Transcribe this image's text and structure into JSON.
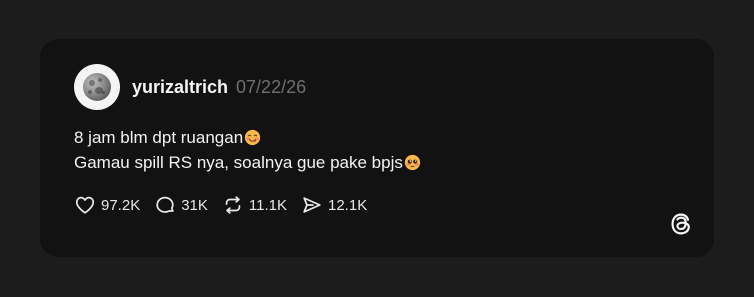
{
  "post": {
    "username": "yurizaltrich",
    "date": "07/22/26",
    "lines": [
      {
        "text": "8 jam blm dpt ruangan",
        "emoji": "face-savoring-food-emoji"
      },
      {
        "text": "Gamau spill RS nya, soalnya gue pake bpjs",
        "emoji": "pleading-face-emoji"
      }
    ],
    "stats": {
      "likes": "97.2K",
      "replies": "31K",
      "reposts": "11.1K",
      "shares": "12.1K"
    }
  },
  "icons": {
    "like": "heart-icon",
    "reply": "speech-bubble-icon",
    "repost": "repost-icon",
    "share": "send-icon",
    "brand": "threads-logo-icon",
    "avatar": "moon-avatar"
  },
  "colors": {
    "page_background": "#1c1c1c",
    "card_background": "#121212",
    "text_primary": "#f5f5f5",
    "text_secondary": "#6f6f6f"
  }
}
